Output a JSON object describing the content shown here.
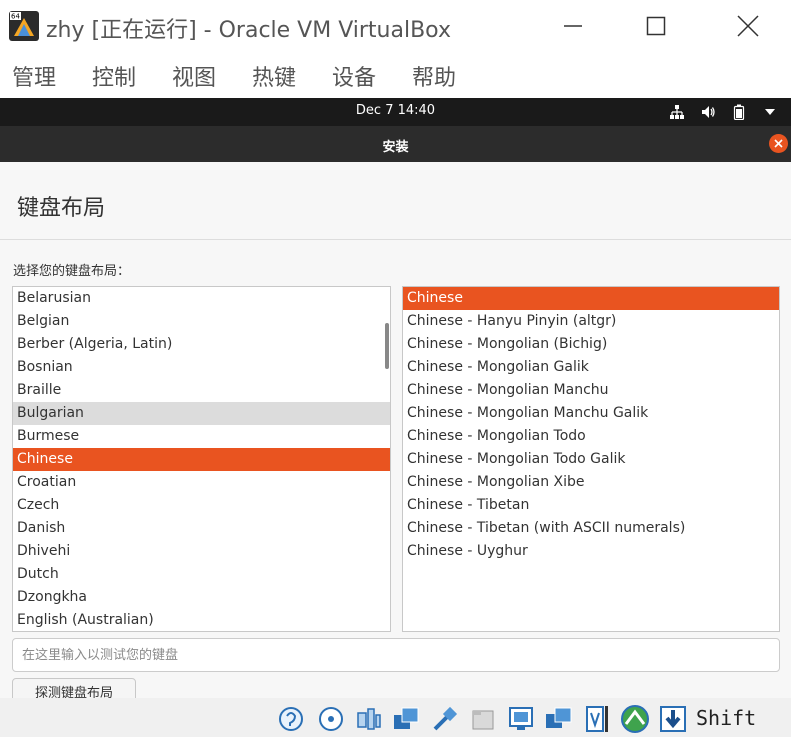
{
  "window": {
    "title": "zhy [正在运行] - Oracle VM VirtualBox",
    "logo_badge": "64"
  },
  "menu": [
    "管理",
    "控制",
    "视图",
    "热键",
    "设备",
    "帮助"
  ],
  "guest_panel": {
    "clock": "Dec 7  14:40",
    "tray_icons": [
      "network-icon",
      "volume-icon",
      "battery-icon",
      "chevron-down-icon"
    ]
  },
  "installer": {
    "title": "安装",
    "heading": "键盘布局",
    "prompt": "选择您的键盘布局：",
    "layouts": [
      "Belarusian",
      "Belgian",
      "Berber (Algeria, Latin)",
      "Bosnian",
      "Braille",
      "Bulgarian",
      "Burmese",
      "Chinese",
      "Croatian",
      "Czech",
      "Danish",
      "Dhivehi",
      "Dutch",
      "Dzongkha",
      "English (Australian)"
    ],
    "selected_layout": "Chinese",
    "hovered_layout": "Bulgarian",
    "variants": [
      "Chinese",
      "Chinese - Hanyu Pinyin (altgr)",
      "Chinese - Mongolian (Bichig)",
      "Chinese - Mongolian Galik",
      "Chinese - Mongolian Manchu",
      "Chinese - Mongolian Manchu Galik",
      "Chinese - Mongolian Todo",
      "Chinese - Mongolian Todo Galik",
      "Chinese - Mongolian Xibe",
      "Chinese - Tibetan",
      "Chinese - Tibetan (with ASCII numerals)",
      "Chinese - Uyghur"
    ],
    "selected_variant": "Chinese",
    "test_input_placeholder": "在这里输入以测试您的键盘",
    "test_input_value": "",
    "detect_button": "探测键盘布局"
  },
  "statusbar": {
    "icons": [
      "hard-disk-icon",
      "optical-drive-icon",
      "audio-icon",
      "network-adapter-icon",
      "usb-icon",
      "shared-folder-icon",
      "display-icon",
      "screen-capture-icon",
      "recording-icon",
      "virtualization-icon",
      "mouse-integration-icon",
      "host-key-arrow-icon"
    ],
    "host_key": "Shift"
  },
  "colors": {
    "accent": "#e95420",
    "panel": "#1a1a1a",
    "header": "#2c2c2c"
  }
}
